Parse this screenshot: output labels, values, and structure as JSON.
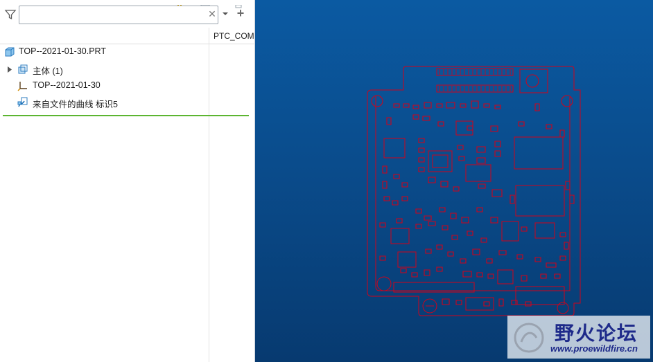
{
  "filter": {
    "value": "",
    "placeholder": ""
  },
  "columns": {
    "ptc": "PTC_COM"
  },
  "tree": [
    {
      "label": "TOP--2021-01-30.PRT"
    },
    {
      "label": "主体 (1)"
    },
    {
      "label": "TOP--2021-01-30"
    },
    {
      "label": "来自文件的曲线 标识5"
    }
  ],
  "watermark": {
    "title": "野火论坛",
    "url": "www.proewildfire.cn"
  },
  "colors": {
    "selection_line": "#5cb531",
    "board_outline": "#d0021b",
    "viewport_top": "#0b5aa2",
    "viewport_bottom": "#073a70"
  }
}
